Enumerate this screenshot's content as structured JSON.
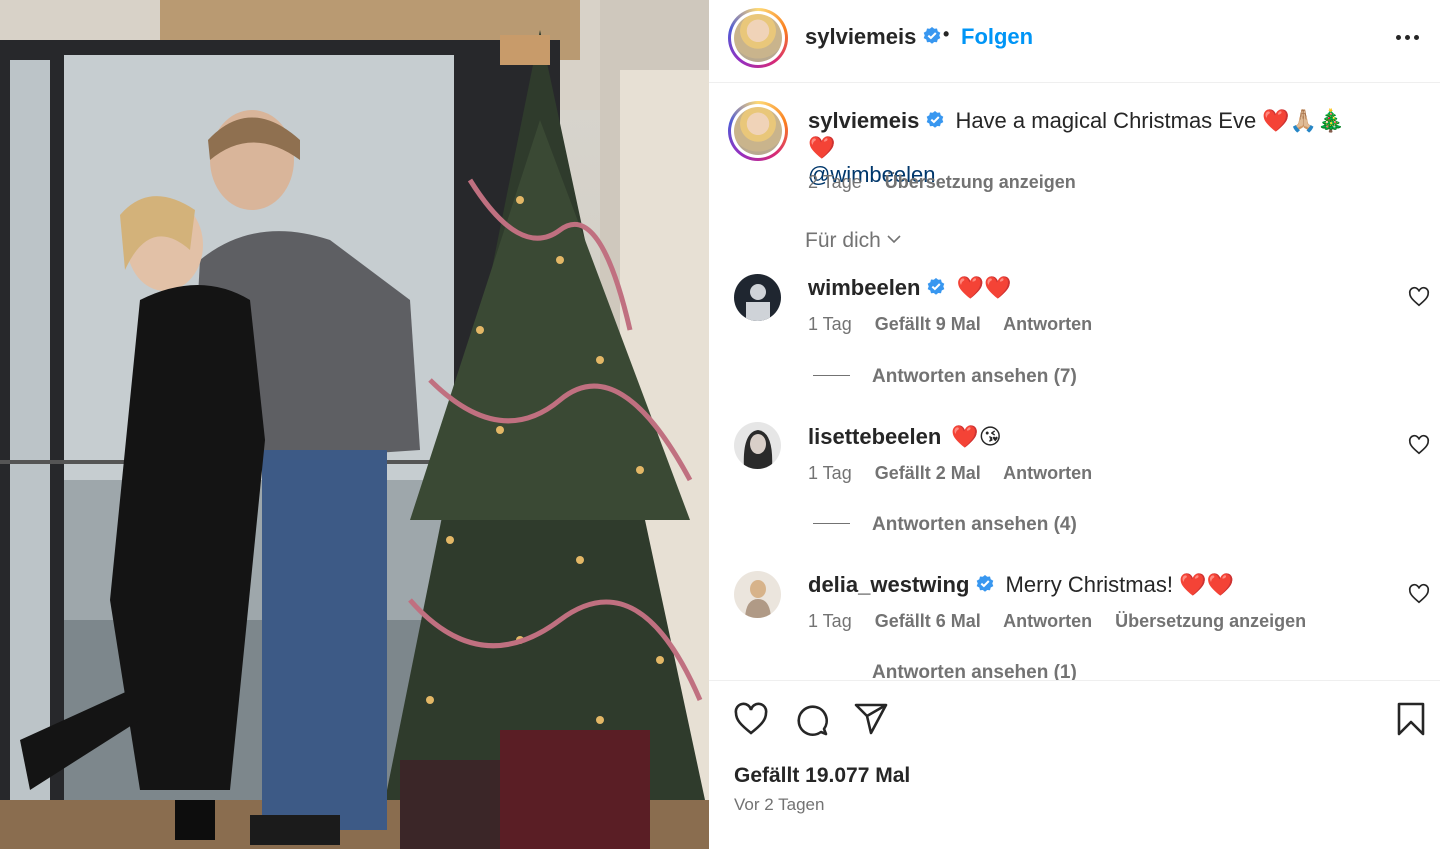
{
  "post": {
    "author": "sylviemeis",
    "follow_label": "Folgen",
    "separator": "•",
    "more_label": "More options"
  },
  "caption": {
    "username": "sylviemeis",
    "text": "Have a magical Christmas Eve ❤️🙏🏼🎄❤️",
    "mention": "@wimbeelen",
    "age": "2 Tage",
    "translate": "Übersetzung anzeigen"
  },
  "filter": {
    "label": "Für dich"
  },
  "comments": [
    {
      "username": "wimbeelen",
      "verified": true,
      "text": "❤️❤️",
      "age": "1 Tag",
      "likes": "Gefällt 9 Mal",
      "reply": "Antworten",
      "translate": "",
      "view_replies": "Antworten ansehen (7)"
    },
    {
      "username": "lisettebeelen",
      "verified": false,
      "text": "❤️😘",
      "age": "1 Tag",
      "likes": "Gefällt 2 Mal",
      "reply": "Antworten",
      "translate": "",
      "view_replies": "Antworten ansehen (4)"
    },
    {
      "username": "delia_westwing",
      "verified": true,
      "text": "Merry Christmas! ❤️❤️",
      "age": "1 Tag",
      "likes": "Gefällt 6 Mal",
      "reply": "Antworten",
      "translate": "Übersetzung anzeigen",
      "view_replies": "Antworten ansehen (1)"
    }
  ],
  "footer": {
    "likes": "Gefällt 19.077 Mal",
    "posted": "Vor 2 Tagen"
  },
  "colors": {
    "link_blue": "#0095f6",
    "mention": "#00376b",
    "verified": "#3897f0",
    "muted": "#737373"
  },
  "icons": [
    "verified-icon",
    "more-icon",
    "heart-icon",
    "comment-icon",
    "share-icon",
    "bookmark-icon",
    "chevron-down-icon"
  ]
}
